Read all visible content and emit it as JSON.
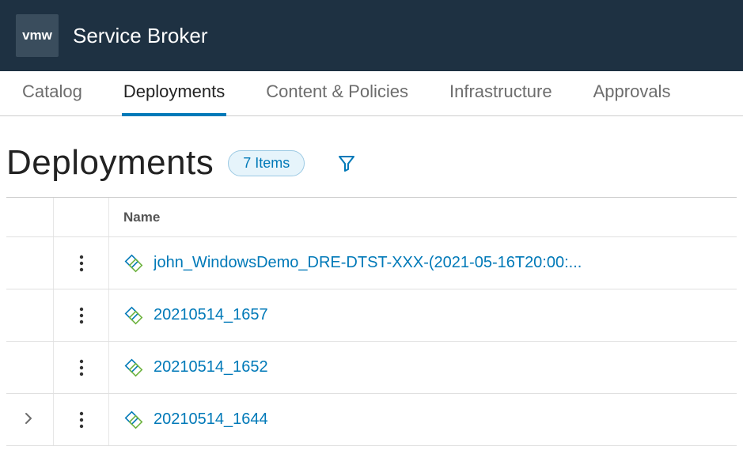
{
  "header": {
    "logo_text": "vmw",
    "app_title": "Service Broker"
  },
  "tabs": [
    {
      "id": "catalog",
      "label": "Catalog",
      "active": false
    },
    {
      "id": "deployments",
      "label": "Deployments",
      "active": true
    },
    {
      "id": "content-policies",
      "label": "Content & Policies",
      "active": false
    },
    {
      "id": "infrastructure",
      "label": "Infrastructure",
      "active": false
    },
    {
      "id": "approvals",
      "label": "Approvals",
      "active": false
    }
  ],
  "page": {
    "title": "Deployments",
    "count_label": "7 Items"
  },
  "columns": {
    "name": "Name"
  },
  "rows": [
    {
      "name": "john_WindowsDemo_DRE-DTST-XXX-(2021-05-16T20:00:...",
      "expandable": false
    },
    {
      "name": "20210514_1657",
      "expandable": false
    },
    {
      "name": "20210514_1652",
      "expandable": false
    },
    {
      "name": "20210514_1644",
      "expandable": true
    }
  ]
}
